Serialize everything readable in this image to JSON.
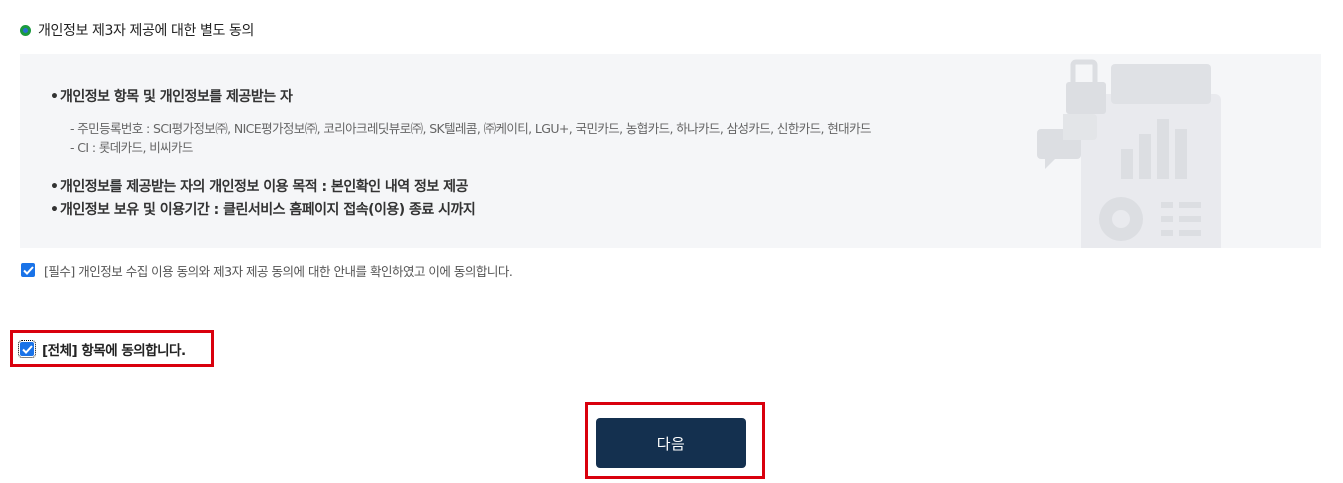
{
  "section": {
    "icon": "ring-icon",
    "title": "개인정보 제3자 제공에 대한 별도 동의"
  },
  "info": {
    "heading1": "개인정보 항목 및 개인정보를 제공받는 자",
    "sub1": "- 주민등록번호 : SCI평가정보㈜, NICE평가정보㈜, 코리아크레딧뷰로㈜, SK텔레콤, ㈜케이티, LGU+, 국민카드, 농협카드, 하나카드, 삼성카드, 신한카드, 현대카드",
    "sub2": "- CI : 롯데카드, 비씨카드",
    "heading2": "개인정보를 제공받는 자의 개인정보 이용 목적 : 본인확인 내역 정보 제공",
    "heading3": "개인정보 보유 및 이용기간 : 클린서비스 홈페이지 접속(이용) 종료 시까지",
    "bullet": "•"
  },
  "agree": {
    "required_label": "[필수] 개인정보 수집 이용 동의와 제3자 제공 동의에 대한 안내를 확인하였고 이에 동의합니다.",
    "all_label": "[전체] 항목에 동의합니다.",
    "required_checked": true,
    "all_checked": true
  },
  "actions": {
    "next_label": "다음"
  },
  "colors": {
    "checkbox": "#1a73e8",
    "button": "#14304f",
    "highlight": "#d9000d",
    "panel": "#f5f6f8"
  }
}
